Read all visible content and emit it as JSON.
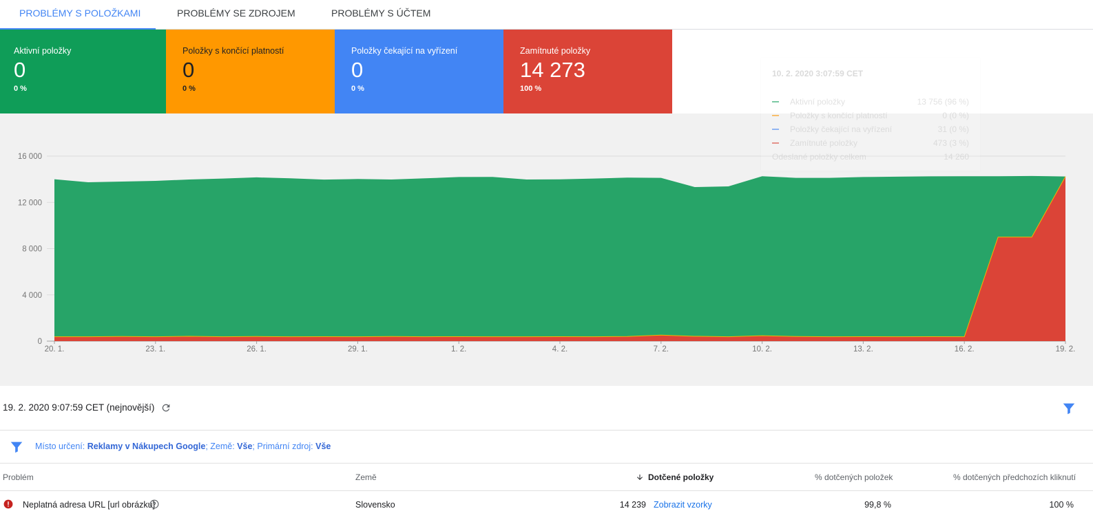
{
  "tabs": [
    {
      "label": "PROBLÉMY S POLOŽKAMI",
      "active": true
    },
    {
      "label": "PROBLÉMY SE ZDROJEM",
      "active": false
    },
    {
      "label": "PROBLÉMY S ÚČTEM",
      "active": false
    }
  ],
  "cards": [
    {
      "label": "Aktivní položky",
      "value": "0",
      "pct": "0 %",
      "color": "#0f9d58"
    },
    {
      "label": "Položky s končící platností",
      "value": "0",
      "pct": "0 %",
      "color": "#ff9800"
    },
    {
      "label": "Položky čekající na vyřízení",
      "value": "0",
      "pct": "0 %",
      "color": "#4285f4"
    },
    {
      "label": "Zamítnuté položky",
      "value": "14 273",
      "pct": "100 %",
      "color": "#db4437"
    }
  ],
  "tooltip": {
    "title": "10. 2. 2020 3:07:59 CET",
    "rows": [
      {
        "name": "Aktivní položky",
        "value": "13 756 (96 %)",
        "color": "#0f9d58"
      },
      {
        "name": "Položky s končící platností",
        "value": "0 (0 %)",
        "color": "#ff9800"
      },
      {
        "name": "Položky čekající na vyřízení",
        "value": "31 (0 %)",
        "color": "#4285f4"
      },
      {
        "name": "Zamítnuté položky",
        "value": "473 (3 %)",
        "color": "#db4437"
      },
      {
        "name": "Odeslané položky celkem",
        "value": "14 260",
        "color": ""
      }
    ]
  },
  "chart_data": {
    "type": "area",
    "stacked": true,
    "y_ticks": [
      "0",
      "4 000",
      "8 000",
      "12 000",
      "16 000"
    ],
    "ylim": [
      0,
      16000
    ],
    "x_ticks": [
      "20. 1.",
      "23. 1.",
      "26. 1.",
      "29. 1.",
      "1. 2.",
      "4. 2.",
      "7. 2.",
      "10. 2.",
      "13. 2.",
      "16. 2.",
      "19. 2."
    ],
    "x_days": [
      0,
      3,
      6,
      9,
      12,
      15,
      18,
      21,
      24,
      27,
      30
    ],
    "series": [
      {
        "name": "Zamítnuté položky",
        "color": "#db4437",
        "points": [
          [
            0,
            380
          ],
          [
            1,
            380
          ],
          [
            2,
            400
          ],
          [
            3,
            380
          ],
          [
            4,
            420
          ],
          [
            5,
            380
          ],
          [
            6,
            400
          ],
          [
            7,
            380
          ],
          [
            8,
            390
          ],
          [
            9,
            380
          ],
          [
            10,
            400
          ],
          [
            11,
            380
          ],
          [
            12,
            390
          ],
          [
            13,
            380
          ],
          [
            14,
            380
          ],
          [
            15,
            390
          ],
          [
            16,
            380
          ],
          [
            17,
            400
          ],
          [
            18,
            520
          ],
          [
            19,
            420
          ],
          [
            20,
            380
          ],
          [
            21,
            470
          ],
          [
            22,
            400
          ],
          [
            23,
            380
          ],
          [
            24,
            390
          ],
          [
            25,
            380
          ],
          [
            26,
            390
          ],
          [
            27,
            380
          ],
          [
            28,
            9000
          ],
          [
            29,
            9000
          ],
          [
            30,
            14239
          ]
        ]
      },
      {
        "name": "Aktivní položky",
        "color": "#27a468",
        "points": [
          [
            0,
            13620
          ],
          [
            1,
            13360
          ],
          [
            2,
            13400
          ],
          [
            3,
            13480
          ],
          [
            4,
            13560
          ],
          [
            5,
            13680
          ],
          [
            6,
            13760
          ],
          [
            7,
            13700
          ],
          [
            8,
            13580
          ],
          [
            9,
            13640
          ],
          [
            10,
            13580
          ],
          [
            11,
            13700
          ],
          [
            12,
            13800
          ],
          [
            13,
            13820
          ],
          [
            14,
            13600
          ],
          [
            15,
            13600
          ],
          [
            16,
            13680
          ],
          [
            17,
            13740
          ],
          [
            18,
            13600
          ],
          [
            19,
            12900
          ],
          [
            20,
            13000
          ],
          [
            21,
            13790
          ],
          [
            22,
            13720
          ],
          [
            23,
            13740
          ],
          [
            24,
            13800
          ],
          [
            25,
            13840
          ],
          [
            26,
            13860
          ],
          [
            27,
            13880
          ],
          [
            28,
            5260
          ],
          [
            29,
            5280
          ],
          [
            30,
            0
          ]
        ]
      }
    ]
  },
  "snapshot": {
    "date_text": "19. 2. 2020 9:07:59 CET (nejnovější)"
  },
  "filter": {
    "prefix1": "Místo určení: ",
    "value1": "Reklamy v Nákupech Google",
    "prefix2": "; Země: ",
    "value2": "Vše",
    "prefix3": "; Primární zdroj: ",
    "value3": "Vše"
  },
  "table": {
    "headers": {
      "problem": "Problém",
      "country": "Země",
      "affected": "Dotčené položky",
      "pct_items": "% dotčených položek",
      "pct_clicks": "% dotčených předchozích kliknutí"
    },
    "rows": [
      {
        "problem": "Neplatná adresa URL [url obrázku]",
        "country": "Slovensko",
        "affected": "14 239",
        "link": "Zobrazit vzorky",
        "pct_items": "99,8 %",
        "pct_clicks": "100 %"
      }
    ]
  },
  "colors": {
    "accent": "#4285f4",
    "green": "#0f9d58",
    "orange": "#ff9800",
    "blue": "#4285f4",
    "red": "#db4437"
  }
}
